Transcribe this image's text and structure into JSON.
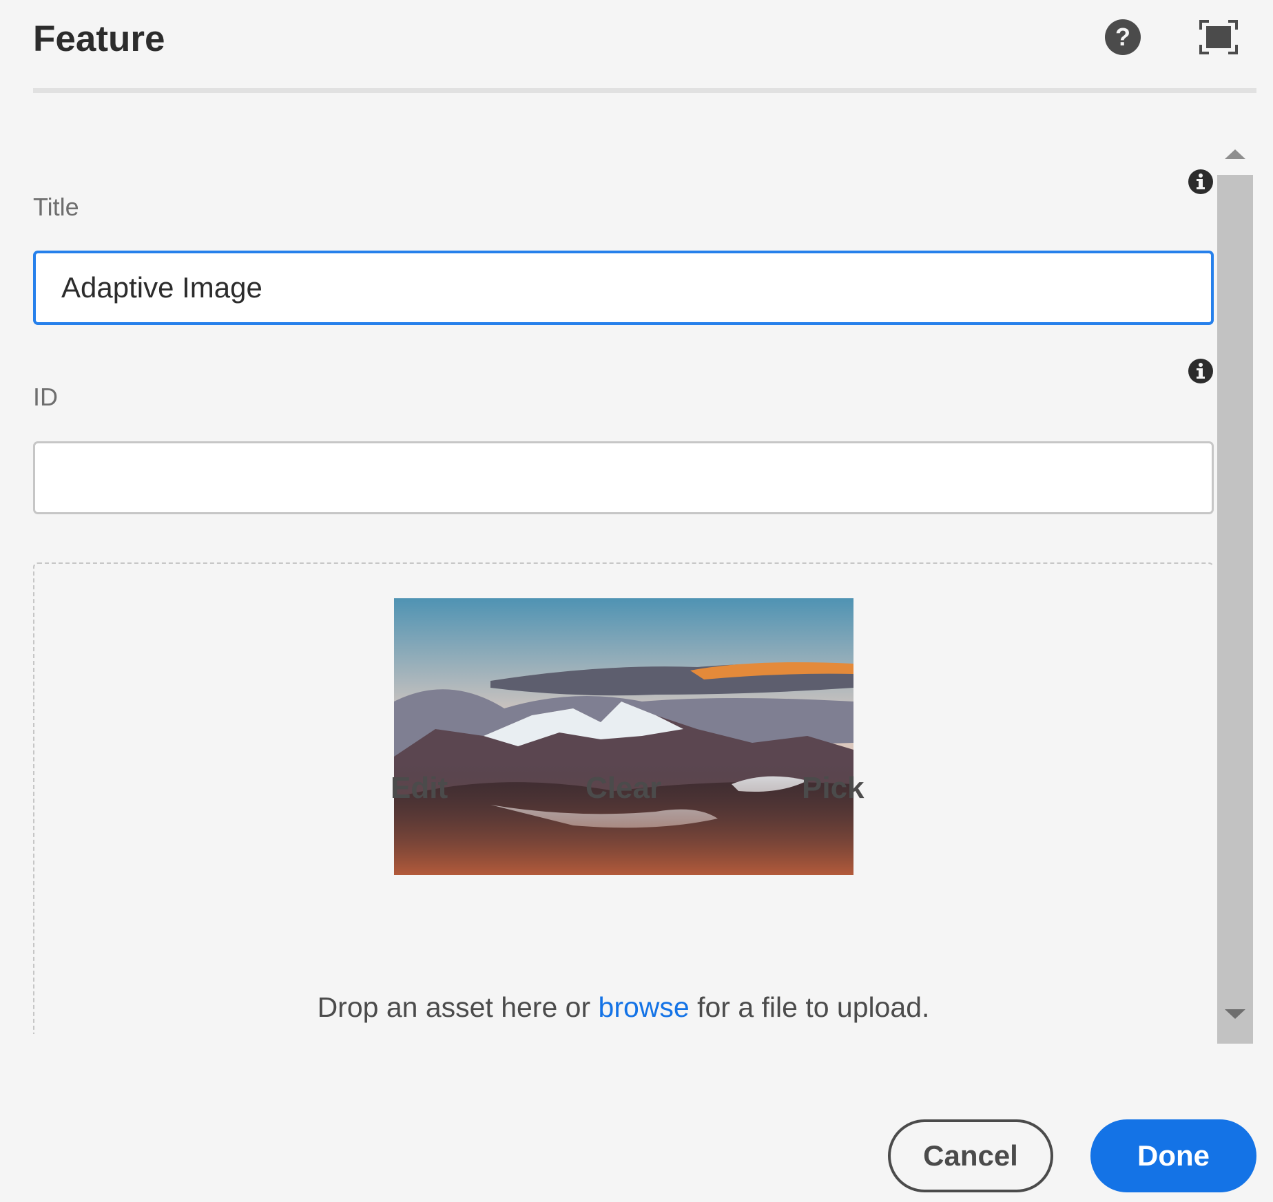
{
  "dialog": {
    "title": "Feature",
    "header_icons": [
      "help-icon",
      "fullscreen-icon"
    ]
  },
  "form": {
    "title_field": {
      "label": "Title",
      "value": "Adaptive Image"
    },
    "id_field": {
      "label": "ID",
      "value": ""
    }
  },
  "asset": {
    "image": "mountain-landscape-photo",
    "actions": {
      "edit": "Edit",
      "clear": "Clear",
      "pick": "Pick"
    },
    "drop_prefix": "Drop an asset here or",
    "browse": "browse",
    "drop_suffix": "for a file to upload."
  },
  "footer": {
    "cancel": "Cancel",
    "done": "Done"
  },
  "colors": {
    "accent": "#1473e6",
    "focus_border": "#2680eb",
    "background": "#f5f5f5"
  }
}
